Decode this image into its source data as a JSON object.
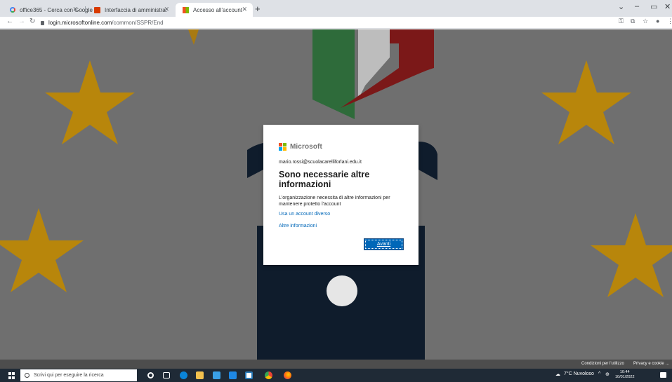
{
  "browser": {
    "tabs": [
      {
        "label": "office365 - Cerca con Google",
        "favicon": "google-icon"
      },
      {
        "label": "Interfaccia di amministrazione di",
        "favicon": "office-icon"
      },
      {
        "label": "Accesso all'account",
        "favicon": "microsoft-icon"
      }
    ],
    "active_tab_index": 2,
    "new_tab_symbol": "+",
    "address": {
      "host": "login.microsoftonline.com",
      "path": "/common/SSPR/End"
    },
    "window_controls": {
      "minimize": "–",
      "maximize": "▫",
      "close": "✕"
    }
  },
  "dialog": {
    "brand": "Microsoft",
    "identity": "mario.rossi@scuolacarelliforlani.edu.it",
    "title": "Sono necessarie altre informazioni",
    "description": "L'organizzazione necessita di altre informazioni per mantenere protetto l'account",
    "link_other_account": "Usa un account diverso",
    "link_more_info": "Altre informazioni",
    "next_label": "Avanti"
  },
  "footer": {
    "terms": "Condizioni per l'utilizzo",
    "privacy": "Privacy e cookie",
    "more": "..."
  },
  "taskbar": {
    "search_placeholder": "Scrivi qui per eseguire la ricerca",
    "weather": "7°C Nuvoloso",
    "time": "10:44",
    "date": "10/01/2022"
  },
  "colors": {
    "accent_blue": "#0067b8",
    "ms_red": "#f25022",
    "ms_green": "#7fba00",
    "ms_blue": "#00a4ef",
    "ms_yellow": "#ffb900",
    "star_gold": "#b8860b"
  }
}
